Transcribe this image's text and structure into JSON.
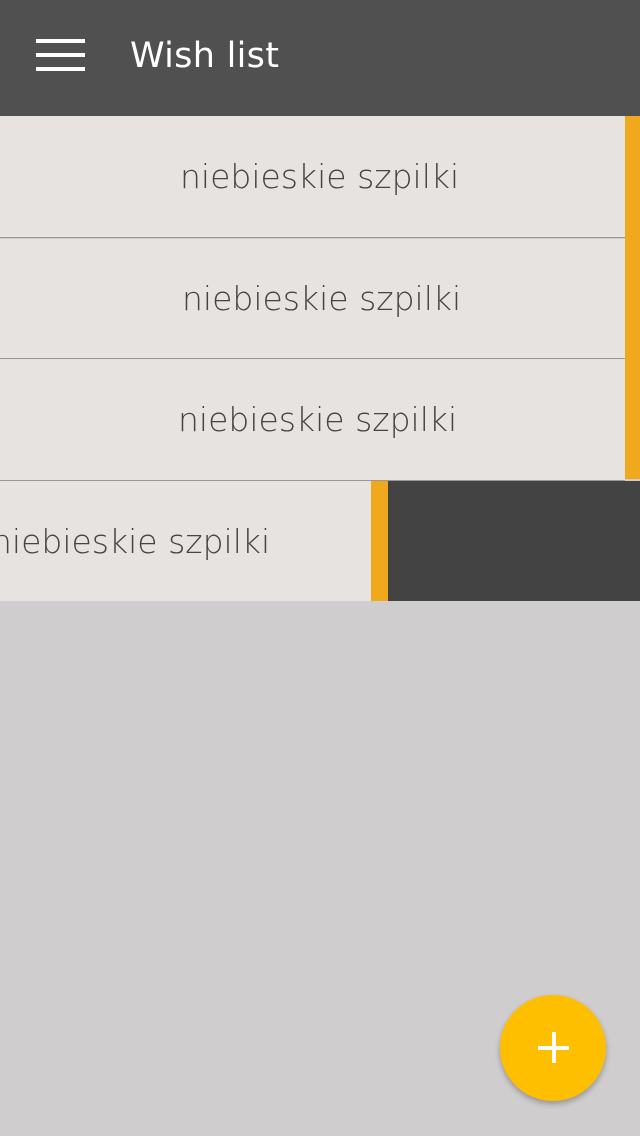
{
  "toolbar": {
    "menu_icon": "hamburger-menu-icon",
    "title": "Wish list"
  },
  "wishlist": {
    "items": [
      {
        "label": "niebieskie szpilki"
      },
      {
        "label": "niebieskie szpilki"
      },
      {
        "label": "niebieskie szpilki"
      },
      {
        "label": "niebieskie szpilki"
      }
    ]
  },
  "fab": {
    "icon": "plus-icon"
  },
  "colors": {
    "toolbar_bg": "#505050",
    "page_bg": "#cfcdce",
    "item_bg": "#e6e3e0",
    "accent": "#f0a81c",
    "swipe_bg": "#434343",
    "fab_bg": "#fdbf00"
  }
}
